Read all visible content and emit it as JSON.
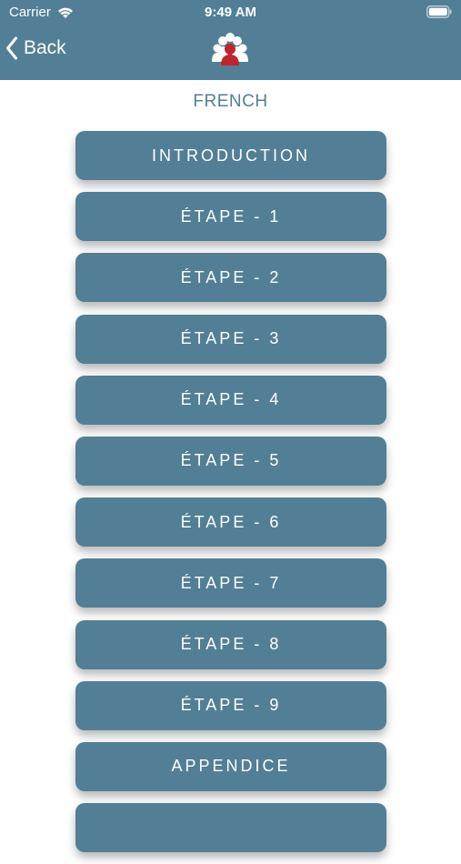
{
  "status_bar": {
    "carrier": "Carrier",
    "time": "9:49 AM"
  },
  "nav": {
    "back_label": "Back",
    "logo_icon": "people-group-logo-icon"
  },
  "section_title": "FRENCH",
  "menu_items": [
    {
      "label": "INTRODUCTION"
    },
    {
      "label": "ÉTAPE - 1"
    },
    {
      "label": "ÉTAPE - 2"
    },
    {
      "label": "ÉTAPE - 3"
    },
    {
      "label": "ÉTAPE - 4"
    },
    {
      "label": "ÉTAPE - 5"
    },
    {
      "label": "ÉTAPE - 6"
    },
    {
      "label": "ÉTAPE - 7"
    },
    {
      "label": "ÉTAPE - 8"
    },
    {
      "label": "ÉTAPE - 9"
    },
    {
      "label": "APPENDICE"
    },
    {
      "label": ""
    }
  ],
  "colors": {
    "primary": "#527f96",
    "logo_accent": "#c0242e",
    "background": "#ffffff"
  }
}
